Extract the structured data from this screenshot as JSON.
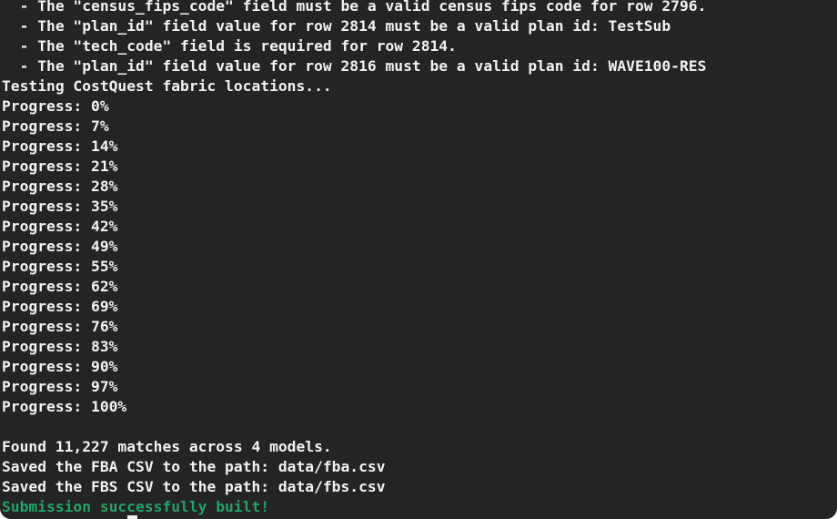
{
  "terminal": {
    "lines": [
      "  - The \"census_fips_code\" field must be a valid census fips code for row 2796.",
      "  - The \"plan_id\" field value for row 2814 must be a valid plan id: TestSub",
      "  - The \"tech_code\" field is required for row 2814.",
      "  - The \"plan_id\" field value for row 2816 must be a valid plan id: WAVE100-RES",
      "Testing CostQuest fabric locations...",
      "Progress: 0%",
      "Progress: 7%",
      "Progress: 14%",
      "Progress: 21%",
      "Progress: 28%",
      "Progress: 35%",
      "Progress: 42%",
      "Progress: 49%",
      "Progress: 55%",
      "Progress: 62%",
      "Progress: 69%",
      "Progress: 76%",
      "Progress: 83%",
      "Progress: 90%",
      "Progress: 97%",
      "Progress: 100%",
      "",
      "Found 11,227 matches across 4 models.",
      "Saved the FBA CSV to the path: data/fba.csv",
      "Saved the FBS CSV to the path: data/fbs.csv",
      "Submission successfully built!"
    ]
  },
  "colors": {
    "background": "#242424",
    "foreground": "#f2f2f2",
    "success": "#26a269"
  }
}
